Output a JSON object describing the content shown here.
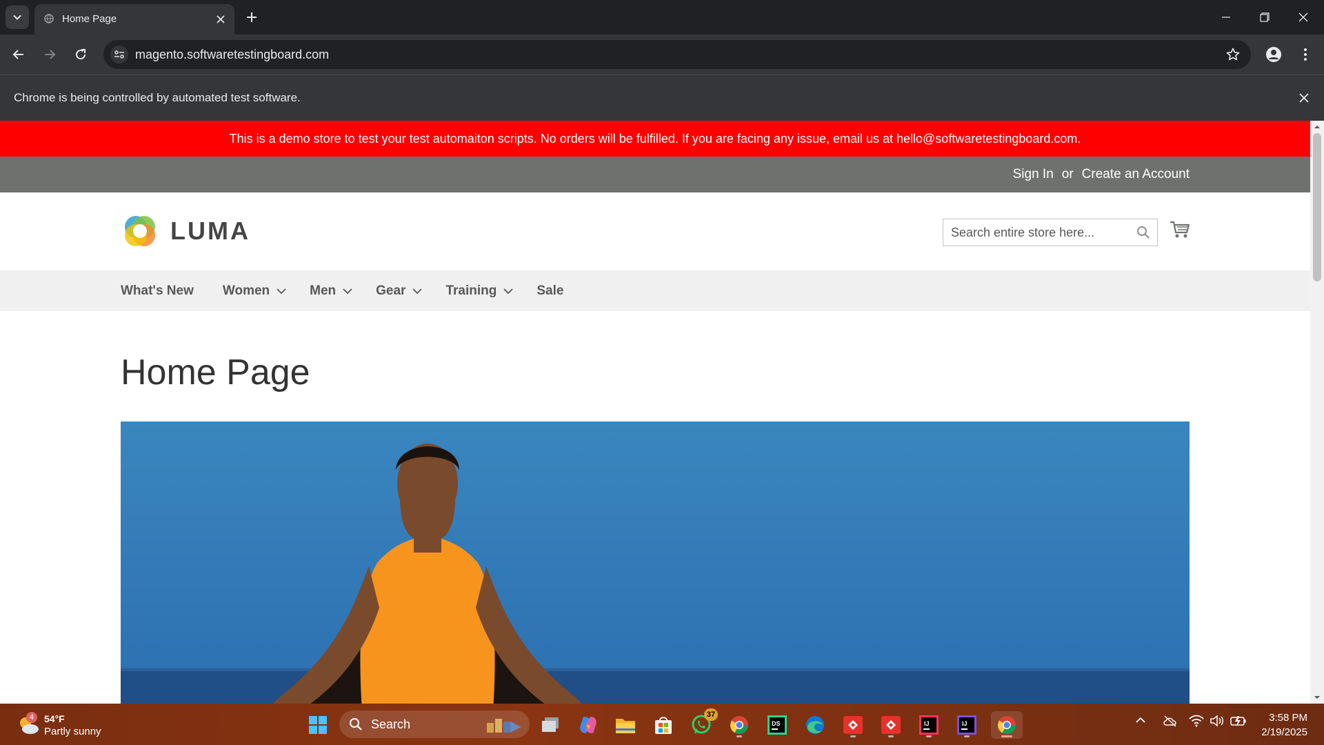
{
  "browser": {
    "tab_title": "Home Page",
    "url": "magento.softwaretestingboard.com",
    "infobar_text": "Chrome is being controlled by automated test software."
  },
  "store": {
    "demo_notice": "This is a demo store to test your test automaiton scripts. No orders will be fulfilled. If you are facing any issue, email us at hello@softwaretestingboard.com.",
    "header_links": {
      "sign_in": "Sign In",
      "or": "or",
      "create_account": "Create an Account"
    },
    "logo_text": "LUMA",
    "search": {
      "placeholder": "Search entire store here...",
      "value": ""
    },
    "nav": [
      {
        "label": "What's New",
        "has_dropdown": false
      },
      {
        "label": "Women",
        "has_dropdown": true
      },
      {
        "label": "Men",
        "has_dropdown": true
      },
      {
        "label": "Gear",
        "has_dropdown": true
      },
      {
        "label": "Training",
        "has_dropdown": true
      },
      {
        "label": "Sale",
        "has_dropdown": false
      }
    ],
    "page_title": "Home Page",
    "colors": {
      "banner": "#ff0000",
      "header_panel": "#6e716e",
      "nav_bg": "#f0f0f0"
    }
  },
  "taskbar": {
    "weather": {
      "badge": "4",
      "temp": "54°F",
      "desc": "Partly sunny"
    },
    "search_label": "Search",
    "whatsapp_badge": "37",
    "apps": [
      "start-icon",
      "task-view-icon",
      "copilot-icon",
      "file-explorer-icon",
      "store-icon",
      "whatsapp-icon",
      "chrome-icon",
      "datagrip-icon",
      "edge-icon",
      "git-icon",
      "git-icon",
      "intellij-icon",
      "intellij-icon",
      "chrome-icon"
    ],
    "clock": {
      "time": "3:58 PM",
      "date": "2/19/2025"
    }
  }
}
